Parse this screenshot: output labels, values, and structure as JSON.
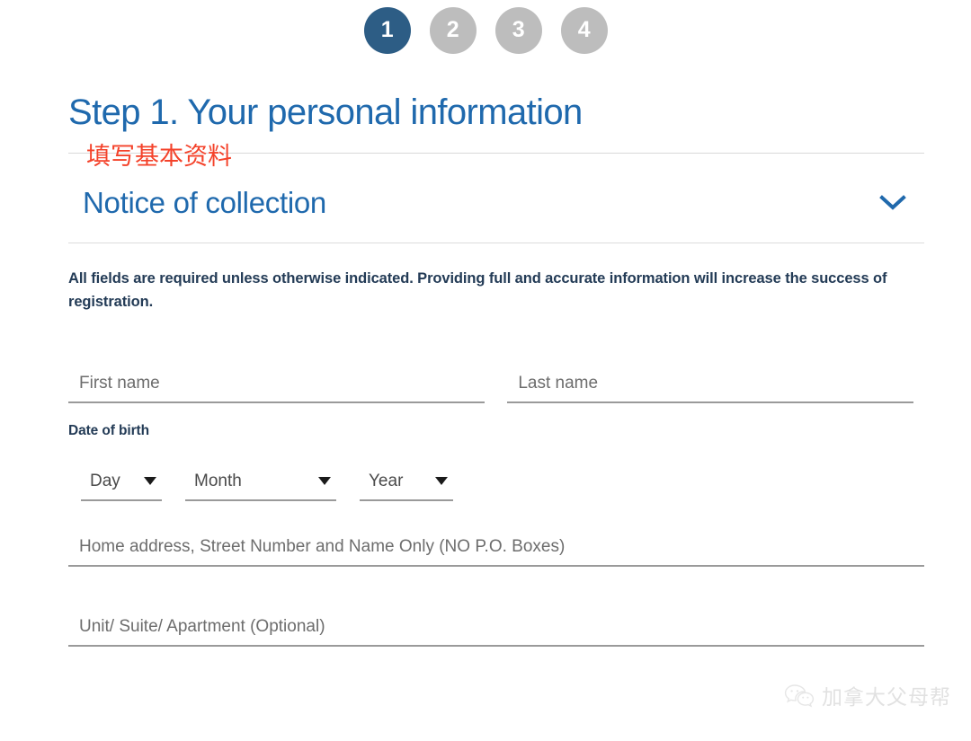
{
  "stepper": {
    "steps": [
      {
        "number": "1",
        "state": "active"
      },
      {
        "number": "2",
        "state": "inactive"
      },
      {
        "number": "3",
        "state": "inactive"
      },
      {
        "number": "4",
        "state": "inactive"
      }
    ]
  },
  "page": {
    "title": "Step 1. Your personal information",
    "annotation_cn": "填写基本资料",
    "title_color": "#1f69ad",
    "annotation_color": "#f4422a"
  },
  "accordion": {
    "title": "Notice of collection",
    "icon": "chevron-down-icon",
    "expanded": "false"
  },
  "instruction": {
    "text": "All fields are required unless otherwise indicated. Providing full and accurate information will increase the success of registration."
  },
  "form": {
    "first_name": {
      "label": "First name",
      "value": ""
    },
    "last_name": {
      "label": "Last name",
      "value": ""
    },
    "date_of_birth": {
      "label": "Date of birth",
      "day": "Day",
      "month": "Month",
      "year": "Year"
    },
    "home_address": {
      "label": "Home address, Street Number and Name Only (NO P.O. Boxes)",
      "value": ""
    },
    "unit": {
      "label": "Unit/ Suite/ Apartment (Optional)",
      "value": ""
    }
  },
  "watermark": {
    "text": "加拿大父母帮",
    "icon": "wechat-icon"
  },
  "colors": {
    "active_step": "#2d5d85",
    "inactive_step": "#bdbdbd",
    "heading_blue": "#1f69ad",
    "annotation_red": "#f4422a",
    "text_navy": "#233b56",
    "underline_gray": "#9a9a9a"
  }
}
